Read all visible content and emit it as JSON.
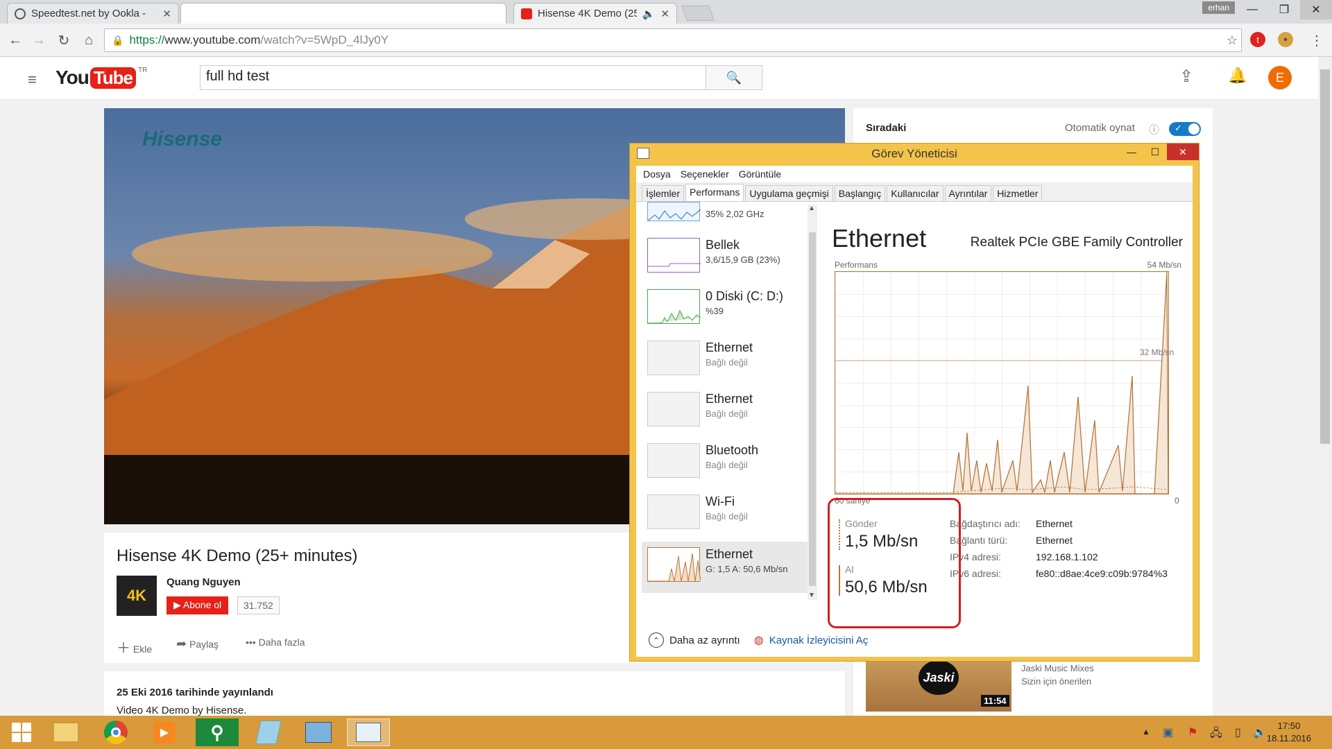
{
  "browser": {
    "tabs": [
      {
        "label": "Speedtest.net by Ookla -"
      },
      {
        "label": ""
      },
      {
        "label": "Hisense 4K Demo (25"
      }
    ],
    "user_label": "erhan",
    "url": {
      "scheme": "https://",
      "host": "www.youtube.com",
      "path": "/watch?v=5WpD_4lJy0Y"
    }
  },
  "youtube": {
    "logo_you": "You",
    "logo_tube": "Tube",
    "logo_region": "TR",
    "search_value": "full hd test",
    "avatar_letter": "E",
    "video_title": "Hisense 4K Demo (25+ minutes)",
    "video_brand": "Hisense",
    "channel": "Quang Nguyen",
    "subscribe": "Abone ol",
    "sub_count": "31.752",
    "actions": {
      "add": "Ekle",
      "share": "Paylaş",
      "more": "Daha fazla"
    },
    "published": "25 Eki 2016 tarihinde yayınlandı",
    "description": "Video 4K Demo by Hisense.",
    "up_next": "Sıradaki",
    "autoplay": "Otomatik oynat",
    "rec": {
      "duration": "11:54",
      "channel": "Jaski Music Mixes",
      "note": "Sizin için önerilen",
      "brand": "Jaski"
    }
  },
  "task_manager": {
    "title": "Görev Yöneticisi",
    "menu": [
      "Dosya",
      "Seçenekler",
      "Görüntüle"
    ],
    "tabs": [
      "İşlemler",
      "Performans",
      "Uygulama geçmişi",
      "Başlangıç",
      "Kullanıcılar",
      "Ayrıntılar",
      "Hizmetler"
    ],
    "selected_tab": "Performans",
    "items": [
      {
        "name": "",
        "sub": "35% 2,02 GHz"
      },
      {
        "name": "Bellek",
        "sub": "3,6/15,9 GB (23%)"
      },
      {
        "name": "0 Diski (C: D:)",
        "sub": "%39"
      },
      {
        "name": "Ethernet",
        "sub": "Bağlı değil"
      },
      {
        "name": "Ethernet",
        "sub": "Bağlı değil"
      },
      {
        "name": "Bluetooth",
        "sub": "Bağlı değil"
      },
      {
        "name": "Wi-Fi",
        "sub": "Bağlı değil"
      },
      {
        "name": "Ethernet",
        "sub": "G: 1,5 A: 50,6 Mb/sn"
      }
    ],
    "detail": {
      "title": "Ethernet",
      "device": "Realtek PCIe GBE Family Controller",
      "perf_label": "Performans",
      "max_label": "54 Mb/sn",
      "mid_label": "32 Mb/sn",
      "zero_label": "0",
      "seconds_label": "60 saniye",
      "send_label": "Gönder",
      "send_value": "1,5 Mb/sn",
      "recv_label": "Al",
      "recv_value": "50,6 Mb/sn",
      "props": [
        {
          "k": "Bağdaştırıcı adı:",
          "v": "Ethernet"
        },
        {
          "k": "Bağlantı türü:",
          "v": "Ethernet"
        },
        {
          "k": "IPv4 adresi:",
          "v": "192.168.1.102"
        },
        {
          "k": "IPv6 adresi:",
          "v": "fe80::d8ae:4ce9:c09b:9784%3"
        }
      ]
    },
    "footer": {
      "fewer": "Daha az ayrıntı",
      "resmon": "Kaynak İzleyicisini Aç"
    }
  },
  "taskbar": {
    "time": "17:50",
    "date": "18.11.2016"
  },
  "colors": {
    "yt_red": "#e62117",
    "tm_accent": "#f4c44a",
    "graph_line": "#b4783e",
    "highlight_box": "#d02020"
  }
}
